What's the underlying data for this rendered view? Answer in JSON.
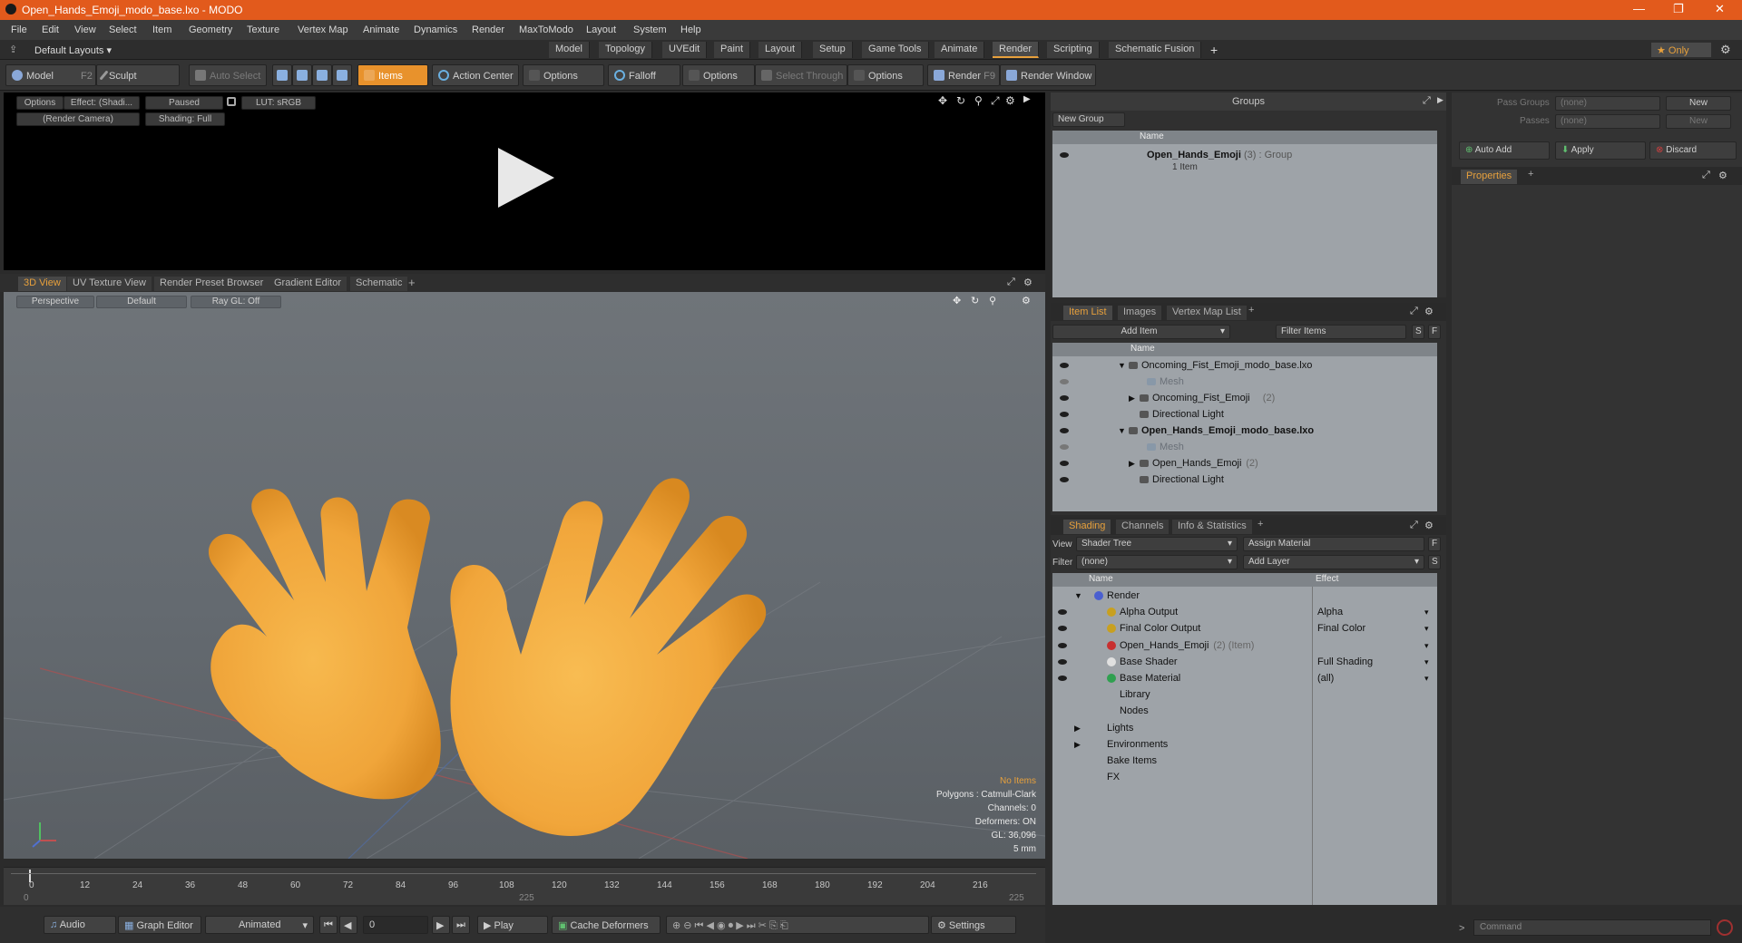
{
  "window": {
    "title": "Open_Hands_Emoji_modo_base.lxo - MODO",
    "min": "—",
    "max": "❐",
    "close": "✕"
  },
  "menu": [
    "File",
    "Edit",
    "View",
    "Select",
    "Item",
    "Geometry",
    "Texture",
    "Vertex Map",
    "Animate",
    "Dynamics",
    "Render",
    "MaxToModo",
    "Layout",
    "System",
    "Help"
  ],
  "layoutbar": {
    "layouts": "Default Layouts ▾",
    "tabs": [
      "Model",
      "Topology",
      "UVEdit",
      "Paint",
      "Layout",
      "Setup",
      "Game Tools",
      "Animate",
      "Render",
      "Scripting",
      "Schematic Fusion"
    ],
    "active": "Render",
    "add": "+",
    "only": "★  Only",
    "gear": "⚙"
  },
  "toolbar": {
    "model": "Model",
    "model_key": "F2",
    "sculpt": "Sculpt",
    "auto_select": "Auto Select",
    "items": "Items",
    "action_center": "Action Center",
    "options1": "Options",
    "falloff": "Falloff",
    "options2": "Options",
    "select_through": "Select Through",
    "options3": "Options",
    "render": "Render",
    "render_key": "F9",
    "render_window": "Render Window"
  },
  "preview": {
    "options": "Options",
    "effect": "Effect: (Shadi...",
    "paused": "Paused",
    "lut": "LUT: sRGB",
    "camera": "(Render Camera)",
    "shading": "Shading: Full"
  },
  "viewtabs": {
    "tabs": [
      "3D View",
      "UV Texture View",
      "Render Preset Browser",
      "Gradient Editor",
      "Schematic"
    ],
    "add": "+"
  },
  "viewport": {
    "perspective": "Perspective",
    "default": "Default",
    "raygl": "Ray GL: Off",
    "stats": [
      "No Items",
      "Polygons : Catmull-Clark",
      "Channels: 0",
      "Deformers: ON",
      "GL: 36,096",
      "5 mm"
    ]
  },
  "timeline": {
    "ticks": [
      "0",
      "12",
      "24",
      "36",
      "48",
      "60",
      "72",
      "84",
      "96",
      "108",
      "120",
      "132",
      "144",
      "156",
      "168",
      "180",
      "192",
      "204",
      "216"
    ],
    "lower": [
      "0",
      "225",
      "225"
    ]
  },
  "bottombar": {
    "audio": "Audio",
    "graph_editor": "Graph Editor",
    "animated": "Animated",
    "frame": "0",
    "play": "Play",
    "cache": "Cache Deformers",
    "settings": "Settings"
  },
  "groups": {
    "title": "Groups",
    "new_group": "New Group",
    "col_name": "Name",
    "item_name": "Open_Hands_Emoji",
    "item_count": "(3)",
    "item_type": ": Group",
    "item_sub": "1 Item"
  },
  "passes": {
    "pass_groups": "Pass Groups",
    "passes": "Passes",
    "none1": "(none)",
    "none2": "(none)",
    "new1": "New",
    "new2": "New",
    "auto_add": "Auto Add",
    "apply": "Apply",
    "discard": "Discard",
    "properties": "Properties",
    "add": "+"
  },
  "itemlist": {
    "tabs": [
      "Item List",
      "Images",
      "Vertex Map List"
    ],
    "add": "+",
    "add_item": "Add Item",
    "filter": "Filter Items",
    "s": "S",
    "f": "F",
    "col_name": "Name",
    "rows": [
      {
        "label": "Oncoming_Fist_Emoji_modo_base.lxo",
        "indent": 0,
        "bold": false,
        "dim": false
      },
      {
        "label": "Mesh",
        "indent": 2,
        "bold": false,
        "dim": true
      },
      {
        "label": "Oncoming_Fist_Emoji",
        "suffix": "(2)",
        "indent": 1,
        "bold": false,
        "dim": false
      },
      {
        "label": "Directional Light",
        "indent": 1,
        "bold": false,
        "dim": false
      },
      {
        "label": "Open_Hands_Emoji_modo_base.lxo",
        "indent": 0,
        "bold": true,
        "dim": false
      },
      {
        "label": "Mesh",
        "indent": 2,
        "bold": false,
        "dim": true
      },
      {
        "label": "Open_Hands_Emoji",
        "suffix": "(2)",
        "indent": 1,
        "bold": false,
        "dim": false
      },
      {
        "label": "Directional Light",
        "indent": 1,
        "bold": false,
        "dim": false
      }
    ]
  },
  "shading": {
    "tabs": [
      "Shading",
      "Channels",
      "Info & Statistics"
    ],
    "add": "+",
    "view_label": "View",
    "view_value": "Shader Tree",
    "assign": "Assign Material",
    "f": "F",
    "filter_label": "Filter",
    "filter_value": "(none)",
    "add_layer": "Add Layer",
    "s": "S",
    "col_name": "Name",
    "col_effect": "Effect",
    "rows": [
      {
        "label": "Render",
        "effect": "",
        "indent": 0,
        "color": "#4a5fd0"
      },
      {
        "label": "Alpha Output",
        "effect": "Alpha",
        "indent": 1,
        "color": "#c8a020"
      },
      {
        "label": "Final Color Output",
        "effect": "Final Color",
        "indent": 1,
        "color": "#c8a020"
      },
      {
        "label": "Open_Hands_Emoji",
        "suffix": "(2) (Item)",
        "effect": "",
        "indent": 1,
        "color": "#c83030"
      },
      {
        "label": "Base Shader",
        "effect": "Full Shading",
        "indent": 1,
        "color": "#e0e0e0"
      },
      {
        "label": "Base Material",
        "effect": "(all)",
        "indent": 1,
        "color": "#30a050"
      },
      {
        "label": "Library",
        "effect": "",
        "indent": 0,
        "color": ""
      },
      {
        "label": "Nodes",
        "effect": "",
        "indent": 0,
        "color": ""
      },
      {
        "label": "Lights",
        "effect": "",
        "indent": -1,
        "color": ""
      },
      {
        "label": "Environments",
        "effect": "",
        "indent": -1,
        "color": ""
      },
      {
        "label": "Bake Items",
        "effect": "",
        "indent": -1,
        "color": ""
      },
      {
        "label": "FX",
        "effect": "",
        "indent": -1,
        "color": ""
      }
    ]
  },
  "command": {
    "placeholder": "Command"
  },
  "colors": {
    "accent": "#e7a03c",
    "title": "#e25a1c",
    "hand": "#f0a53a"
  }
}
